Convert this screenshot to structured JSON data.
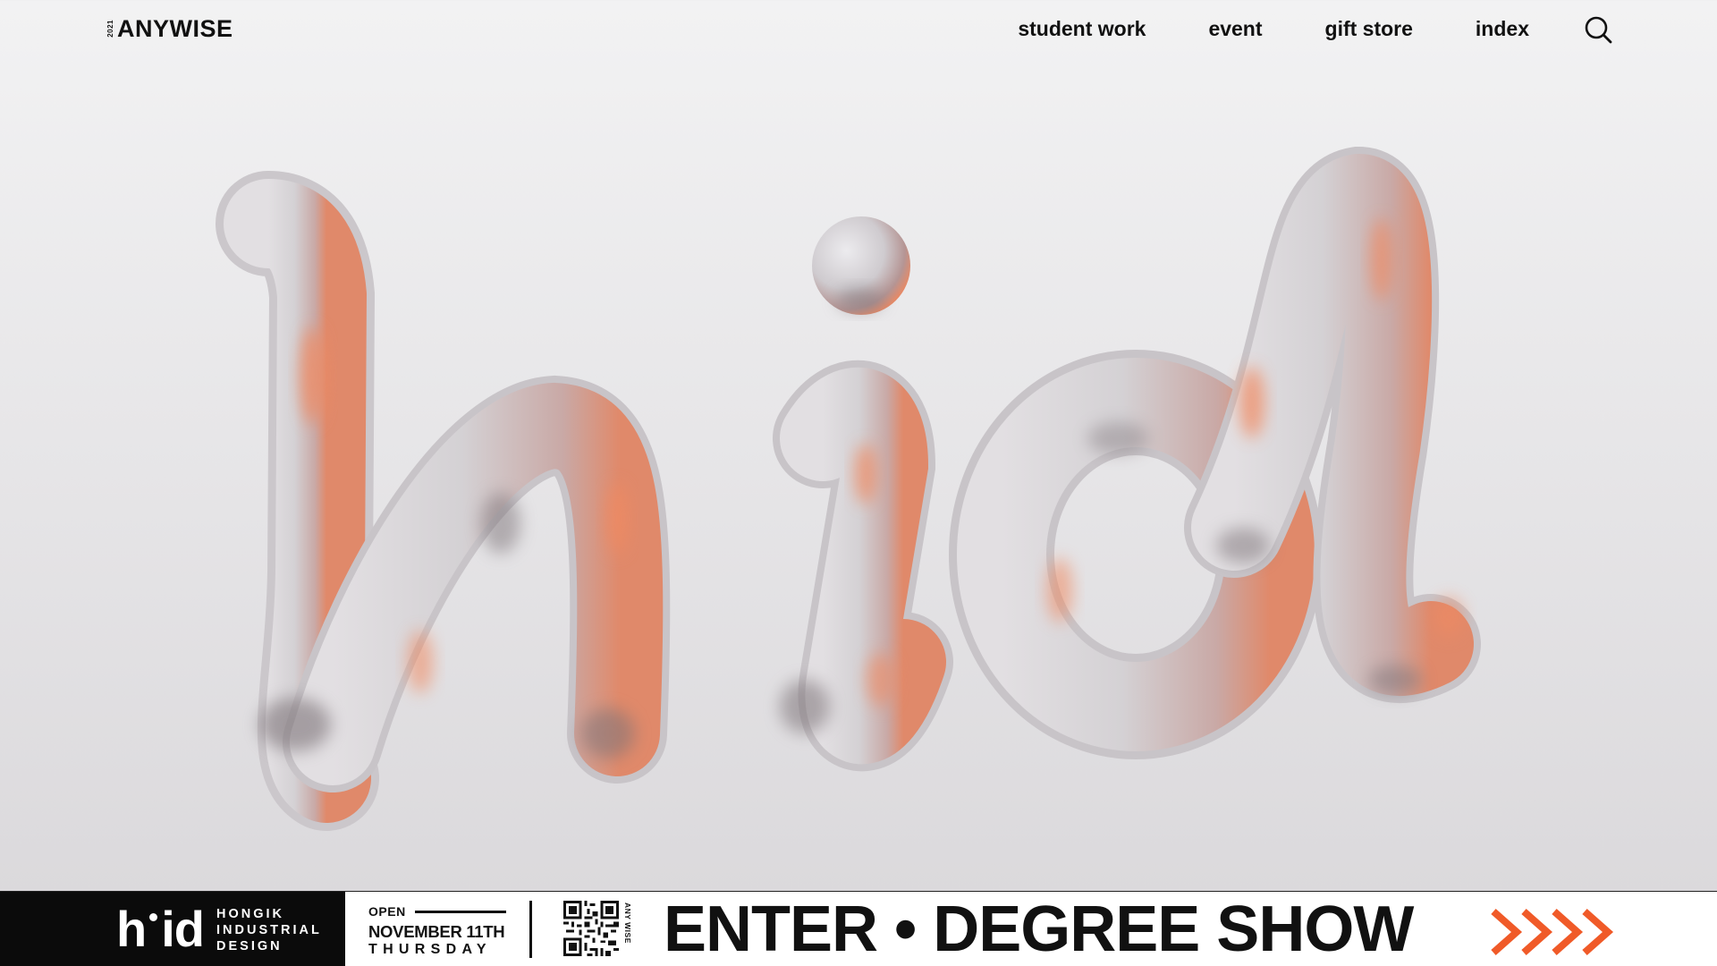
{
  "header": {
    "logo_year": "2021",
    "logo_name": "ANYWISE",
    "nav": [
      "student work",
      "event",
      "gift store",
      "index"
    ],
    "search_icon": "search-icon"
  },
  "hero": {
    "artwork": "3D chrome letters h i d",
    "colors": {
      "chrome_base": "#d8d5d8",
      "chrome_shadow": "#8a8186",
      "copper_highlight": "#e58a68"
    }
  },
  "banner": {
    "brand_mark": "h",
    "brand_mark_tail": "id",
    "brand_lines": [
      "HONGIK",
      "INDUSTRIAL",
      "DESIGN"
    ],
    "open_label": "OPEN",
    "open_date": "NOVEMBER 11TH",
    "open_day": "THURSDAY",
    "qr_caption": "ANY WISE",
    "cta_label": "ENTER • DEGREE SHOW",
    "arrow_color": "#f05a28",
    "brand_bg": "#0b0b0b"
  }
}
